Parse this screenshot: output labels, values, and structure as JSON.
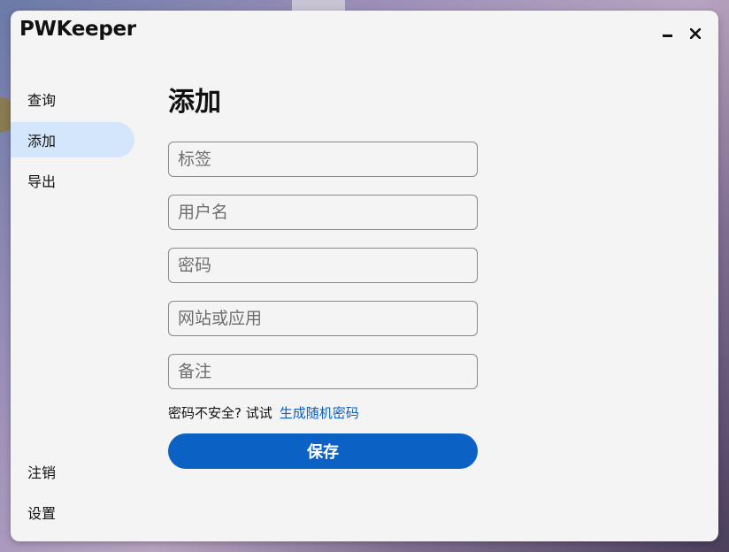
{
  "app": {
    "title": "PWKeeper"
  },
  "window_controls": {
    "minimize": "",
    "close": "✕"
  },
  "sidebar": {
    "items": [
      {
        "label": "查询"
      },
      {
        "label": "添加"
      },
      {
        "label": "导出"
      }
    ],
    "bottom_items": [
      {
        "label": "注销"
      },
      {
        "label": "设置"
      }
    ]
  },
  "main": {
    "title": "添加",
    "fields": {
      "tag": {
        "placeholder": "标签",
        "value": ""
      },
      "username": {
        "placeholder": "用户名",
        "value": ""
      },
      "password": {
        "placeholder": "密码",
        "value": ""
      },
      "site": {
        "placeholder": "网站或应用",
        "value": ""
      },
      "note": {
        "placeholder": "备注",
        "value": ""
      }
    },
    "hint": {
      "text": "密码不安全? 试试",
      "link": "生成随机密码"
    },
    "save_label": "保存"
  },
  "colors": {
    "accent": "#0b62c4",
    "active_nav": "#d4e6fb",
    "link": "#0b5fc0"
  }
}
